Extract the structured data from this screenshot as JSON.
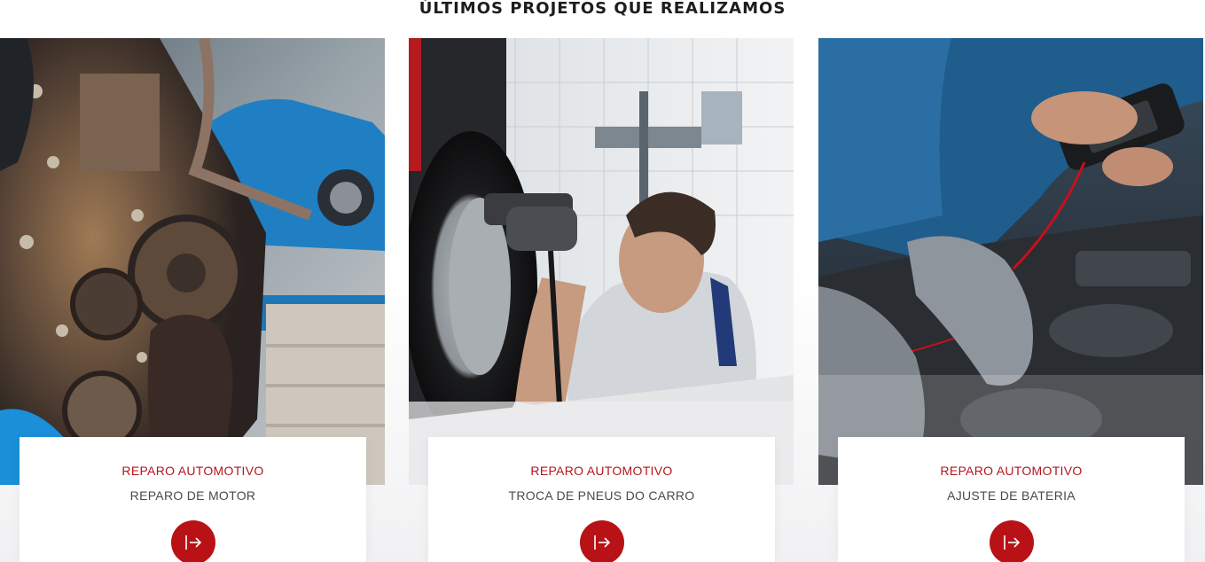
{
  "section": {
    "title": "ÚLTIMOS PROJETOS QUE REALIZAMOS"
  },
  "projects": [
    {
      "category": "REPARO AUTOMOTIVO",
      "title": "REPARO DE MOTOR",
      "icon": "arrow-right-icon",
      "photo": "engine-repair-photo"
    },
    {
      "category": "REPARO AUTOMOTIVO",
      "title": "TROCA DE PNEUS DO CARRO",
      "icon": "arrow-right-icon",
      "photo": "tire-change-photo"
    },
    {
      "category": "REPARO AUTOMOTIVO",
      "title": "AJUSTE DE BATERIA",
      "icon": "arrow-right-icon",
      "photo": "battery-adjust-photo"
    }
  ],
  "colors": {
    "accent": "#b81217",
    "category_text": "#b3161b",
    "title_text": "#4a4a4a",
    "heading_text": "#1d1d1f"
  }
}
